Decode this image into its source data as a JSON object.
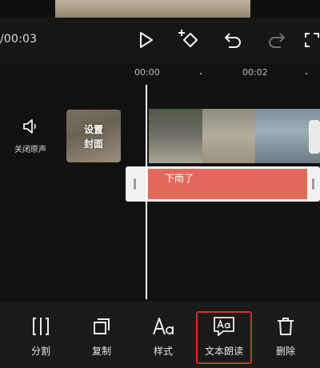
{
  "player": {
    "time_display": "/00:03"
  },
  "ruler": {
    "tick_labels": [
      "00:00",
      "00:02"
    ]
  },
  "track": {
    "mute_label": "关闭原声",
    "cover_label_line1": "设置",
    "cover_label_line2": "封面"
  },
  "text_clip": {
    "text": "下雨了",
    "color": "#e4685a"
  },
  "toolbar": {
    "split_label": "分割",
    "copy_label": "复制",
    "style_label": "样式",
    "tts_label": "文本朗读",
    "delete_label": "删除"
  },
  "highlight_color": "#e0292b"
}
